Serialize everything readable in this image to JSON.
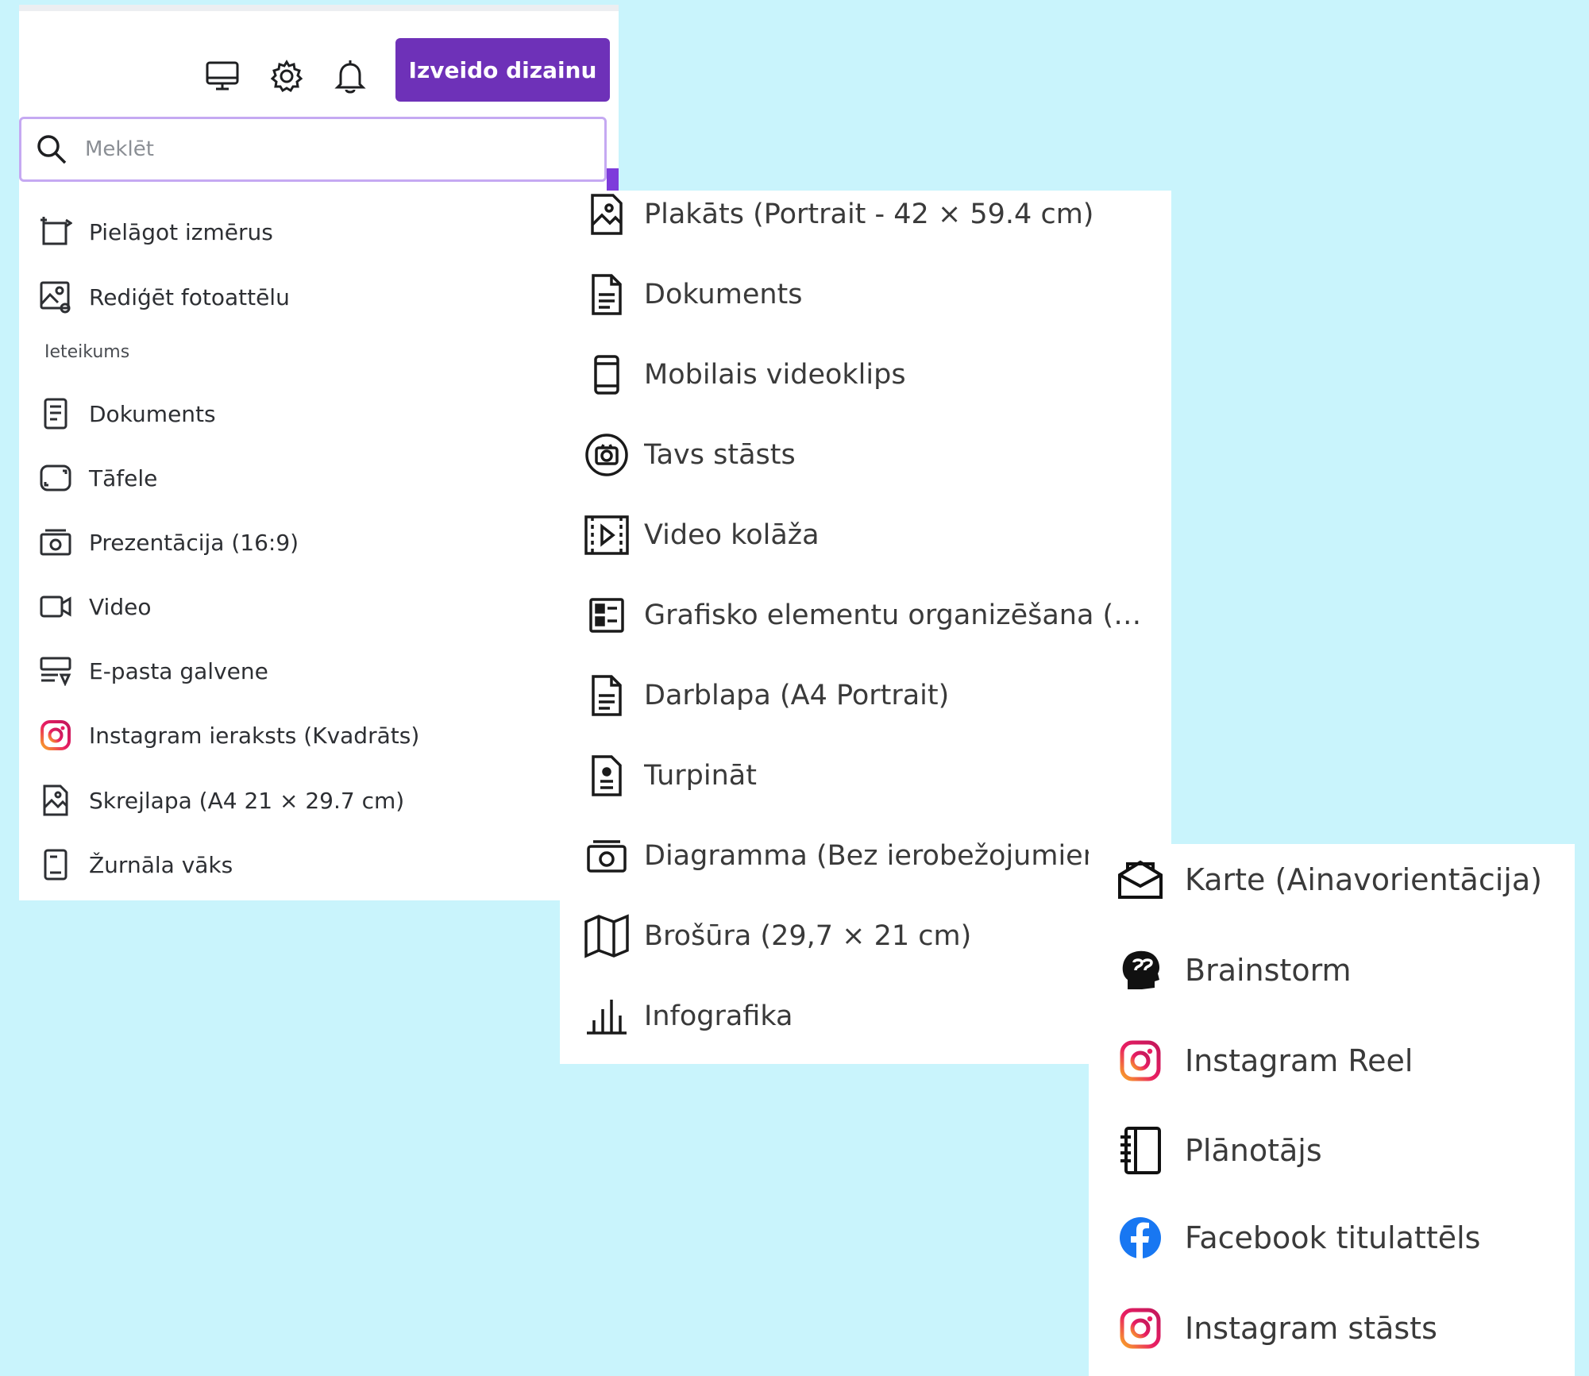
{
  "header": {
    "create_button": "Izveido dizainu",
    "icons": [
      "monitor-icon",
      "gear-icon",
      "bell-icon"
    ]
  },
  "search": {
    "placeholder": "Meklēt"
  },
  "panel1": {
    "tools": [
      {
        "label": "Pielāgot izmērus",
        "icon": "resize-icon"
      },
      {
        "label": "Rediģēt fotoattēlu",
        "icon": "edit-photo-icon"
      }
    ],
    "section_label": "Ieteikums",
    "suggestions": [
      {
        "label": "Dokuments",
        "icon": "document-icon"
      },
      {
        "label": "Tāfele",
        "icon": "whiteboard-icon"
      },
      {
        "label": "Prezentācija (16:9)",
        "icon": "presentation-icon"
      },
      {
        "label": "Video",
        "icon": "video-icon"
      },
      {
        "label": "E-pasta galvene",
        "icon": "email-header-icon"
      },
      {
        "label": "Instagram ieraksts (Kvadrāts)",
        "icon": "instagram-icon"
      },
      {
        "label": "Skrejlapa (A4 21 × 29.7 cm)",
        "icon": "flyer-icon"
      },
      {
        "label": "Žurnāla vāks",
        "icon": "magazine-icon"
      }
    ]
  },
  "panel2": {
    "items": [
      {
        "label": "Plakāts (Portrait - 42 × 59.4 cm)",
        "icon": "poster-icon"
      },
      {
        "label": "Dokuments",
        "icon": "document-icon"
      },
      {
        "label": "Mobilais videoklips",
        "icon": "phone-icon"
      },
      {
        "label": "Tavs stāsts",
        "icon": "camera-circle-icon"
      },
      {
        "label": "Video kolāža",
        "icon": "video-collage-icon"
      },
      {
        "label": "Grafisko elementu organizēšana (B...",
        "icon": "organizer-icon"
      },
      {
        "label": "Darblapa (A4 Portrait)",
        "icon": "worksheet-icon"
      },
      {
        "label": "Turpināt",
        "icon": "resume-icon"
      },
      {
        "label": "Diagramma (Bez ierobežojumiem",
        "icon": "diagram-icon"
      },
      {
        "label": "Brošūra (29,7 × 21 cm)",
        "icon": "map-icon"
      },
      {
        "label": "Infografika",
        "icon": "bar-chart-icon"
      }
    ]
  },
  "panel3": {
    "items": [
      {
        "label": "Karte (Ainavorientācija)",
        "icon": "card-envelope-icon"
      },
      {
        "label": "Brainstorm",
        "icon": "brainstorm-head-icon"
      },
      {
        "label": "Instagram Reel",
        "icon": "instagram-icon"
      },
      {
        "label": "Plānotājs",
        "icon": "planner-icon"
      },
      {
        "label": "Facebook titulattēls",
        "icon": "facebook-icon"
      },
      {
        "label": "Instagram stāsts",
        "icon": "instagram-icon"
      }
    ]
  },
  "colors": {
    "background": "#c9f4fc",
    "button": "#6e31b8",
    "search_border": "#c5a9f2",
    "facebook": "#1877f2"
  }
}
